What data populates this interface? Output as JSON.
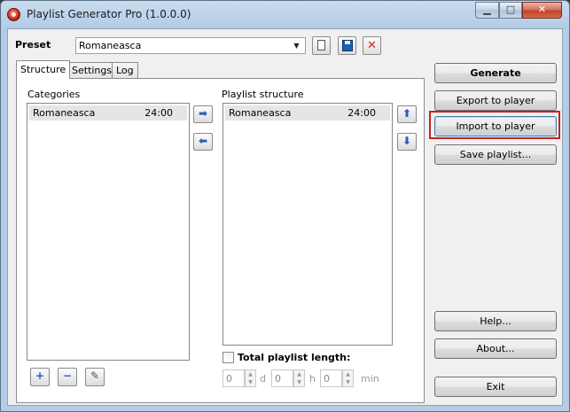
{
  "window": {
    "title": "Playlist Generator Pro (1.0.0.0)"
  },
  "preset": {
    "label": "Preset",
    "value": "Romaneasca"
  },
  "tabs": [
    {
      "label": "Structure",
      "active": true
    },
    {
      "label": "Settings",
      "active": false
    },
    {
      "label": "Log",
      "active": false
    }
  ],
  "categories": {
    "label": "Categories",
    "items": [
      {
        "name": "Romaneasca",
        "duration": "24:00"
      }
    ]
  },
  "playlist_structure": {
    "label": "Playlist structure",
    "items": [
      {
        "name": "Romaneasca",
        "duration": "24:00"
      }
    ]
  },
  "total_length": {
    "label": "Total playlist length:",
    "checked": false,
    "days": {
      "value": "0",
      "unit": "d"
    },
    "hours": {
      "value": "0",
      "unit": "h"
    },
    "minutes": {
      "value": "0",
      "unit": "min"
    }
  },
  "buttons": {
    "generate": "Generate",
    "export": "Export to player",
    "import": "Import to player",
    "save_playlist": "Save playlist...",
    "help": "Help...",
    "about": "About...",
    "exit": "Exit"
  },
  "icons": {
    "app": "app-icon",
    "new": "new-document-icon",
    "save": "floppy-save-icon",
    "delete": "delete-x-icon",
    "move_right": "arrow-right-icon",
    "move_left": "arrow-left-icon",
    "move_up": "arrow-up-icon",
    "move_down": "arrow-down-icon",
    "add": "plus-icon",
    "remove": "minus-icon",
    "edit": "edit-icon"
  },
  "colors": {
    "highlight_border": "#cc1f1f",
    "arrow_blue": "#2a5db8"
  }
}
